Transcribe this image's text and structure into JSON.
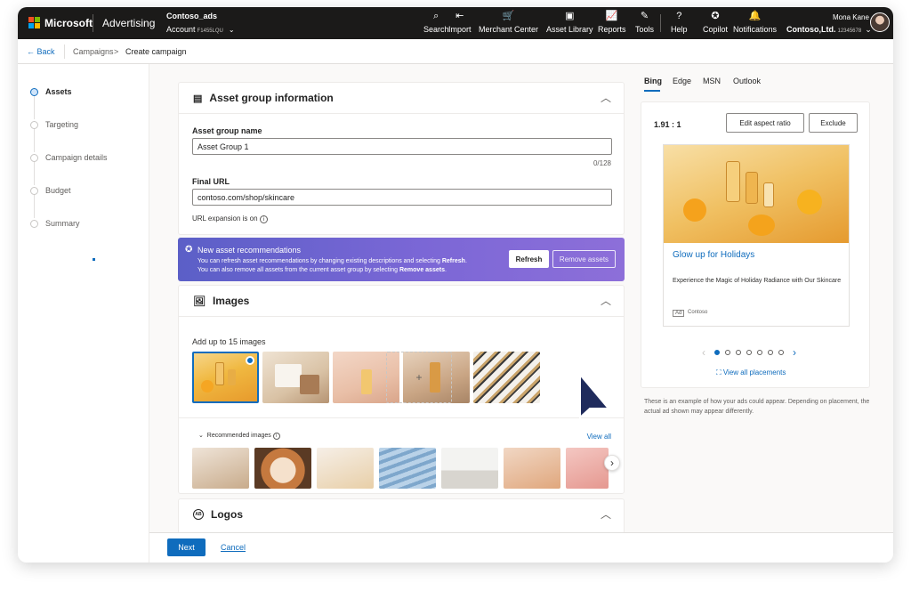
{
  "topbar": {
    "brand": "Microsoft",
    "product": "Advertising",
    "account_name": "Contoso_ads",
    "account_label": "Account",
    "account_id": "F1455LQU",
    "nav": [
      {
        "label": "Search",
        "icon": "search-icon",
        "glyph": "⌕"
      },
      {
        "label": "Import",
        "icon": "import-icon",
        "glyph": "⇤"
      },
      {
        "label": "Merchant Center",
        "icon": "cart-icon",
        "glyph": "🛒"
      },
      {
        "label": "Asset Library",
        "icon": "library-icon",
        "glyph": "▣"
      },
      {
        "label": "Reports",
        "icon": "chart-icon",
        "glyph": "📈"
      },
      {
        "label": "Tools",
        "icon": "wrench-icon",
        "glyph": "✎"
      },
      {
        "label": "Help",
        "icon": "help-icon",
        "glyph": "?"
      },
      {
        "label": "Copilot",
        "icon": "copilot-icon",
        "glyph": "✪"
      },
      {
        "label": "Notifications",
        "icon": "bell-icon",
        "glyph": "🔔"
      }
    ],
    "user_name": "Mona Kane",
    "org_name": "Contoso,Ltd.",
    "org_id": "12345678"
  },
  "breadcrumb": {
    "back": "Back",
    "parent": "Campaigns",
    "separator": ">",
    "current": "Create campaign"
  },
  "steps": [
    {
      "label": "Assets",
      "active": true
    },
    {
      "label": "Targeting",
      "active": false
    },
    {
      "label": "Campaign details",
      "active": false
    },
    {
      "label": "Budget",
      "active": false
    },
    {
      "label": "Summary",
      "active": false
    }
  ],
  "asset_group": {
    "title": "Asset group information",
    "name_label": "Asset group name",
    "name_value": "Asset Group 1",
    "name_counter": "0/128",
    "url_label": "Final URL",
    "url_value": "contoso.com/shop/skincare",
    "url_expansion": "URL expansion is on"
  },
  "banner": {
    "title": "New asset recommendations",
    "line1_pre": "You can refresh asset recommendations by changing existing descriptions and selecting ",
    "line1_bold": "Refresh",
    "line1_post": ".",
    "line2_pre": "You can also remove all assets from the current asset group by selecting ",
    "line2_bold": "Remove assets",
    "line2_post": ".",
    "refresh_label": "Refresh",
    "remove_label": "Remove assets"
  },
  "images": {
    "title": "Images",
    "hint": "Add up to 15 images",
    "recommended_label": "Recommended images",
    "view_all": "View all",
    "add_symbol": "+",
    "next_symbol": "›"
  },
  "logos": {
    "title": "Logos"
  },
  "footer": {
    "next_label": "Next",
    "cancel_label": "Cancel"
  },
  "preview": {
    "tabs": [
      "Bing",
      "Edge",
      "MSN",
      "Outlook"
    ],
    "ratio": "1.91 : 1",
    "edit_ratio_label": "Edit aspect ratio",
    "exclude_label": "Exclude",
    "ad_title": "Glow up for Holidays",
    "ad_desc": "Experience the Magic of Holiday Radiance with Our Skincare",
    "ad_badge": "Ad",
    "ad_advertiser": "Contoso",
    "view_all_placements": "View all placements",
    "note": "These is an example of how your ads could appear. Depending on placement, the actual ad shown may appear differently.",
    "page_count": 7,
    "current_page": 1
  }
}
